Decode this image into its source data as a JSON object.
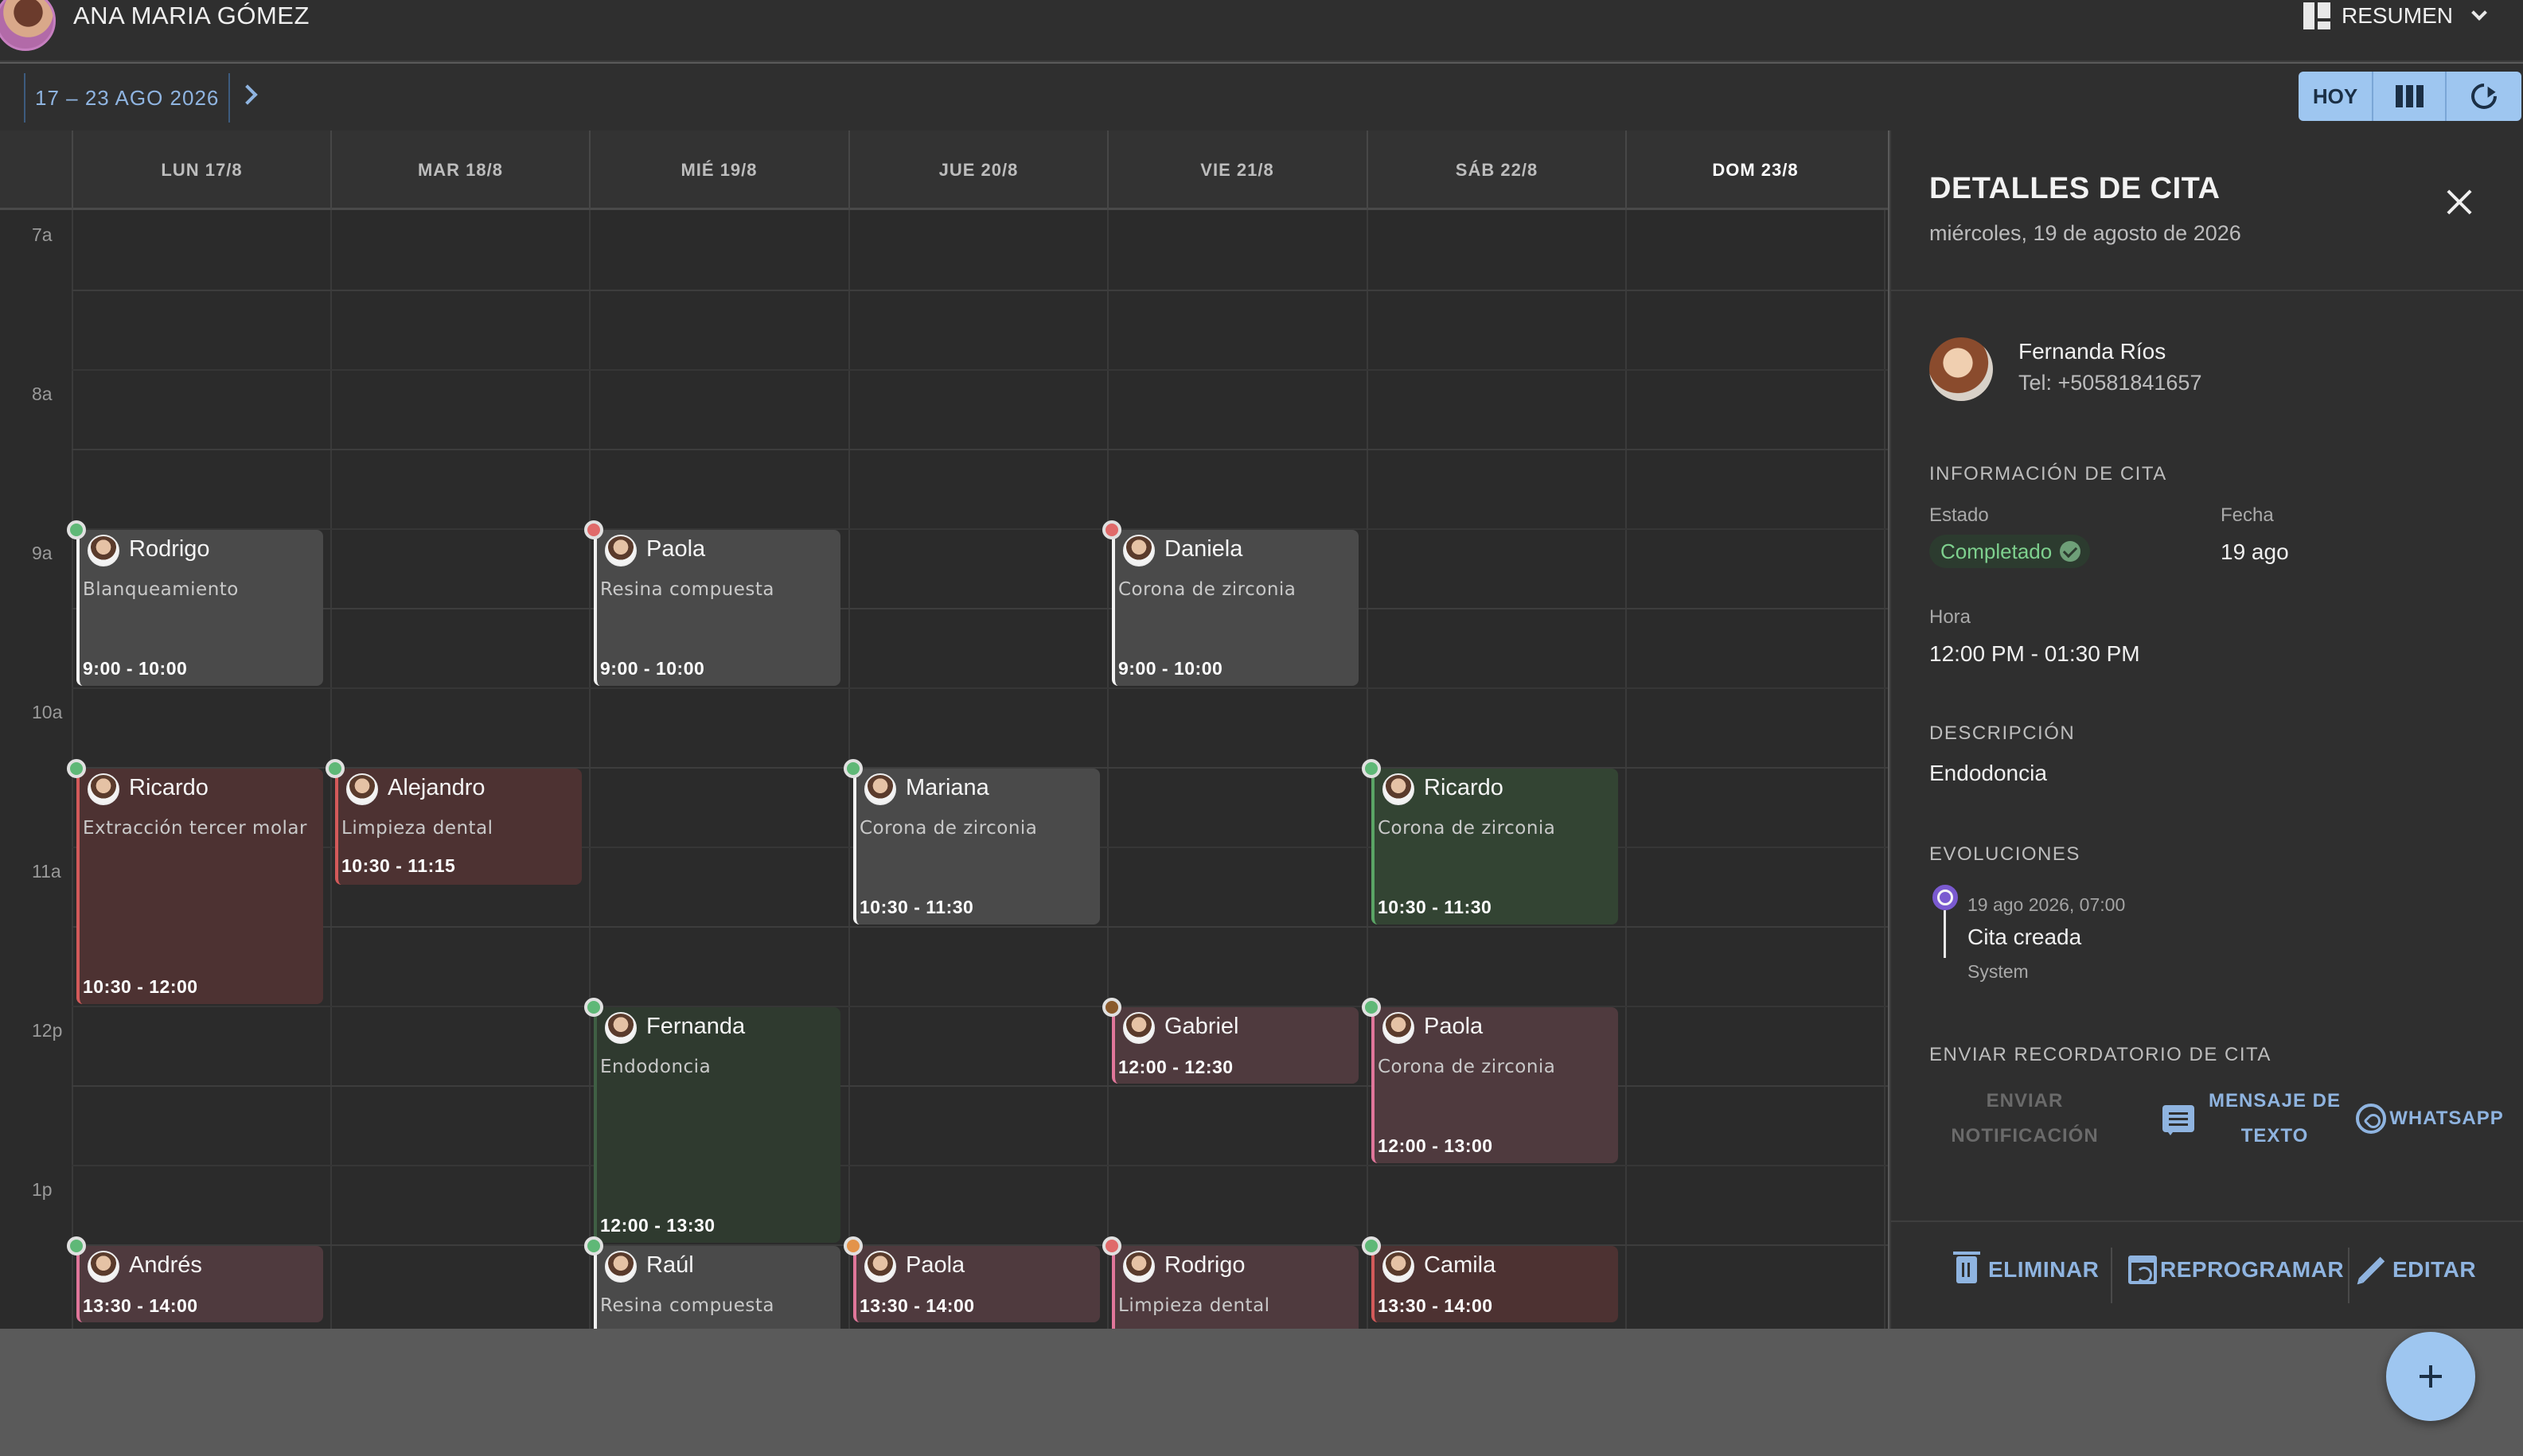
{
  "header": {
    "user_name": "ANA MARIA GÓMEZ",
    "summary_label": "RESUMEN"
  },
  "toolbar": {
    "date_range": "17 – 23 AGO 2026",
    "today_label": "HOY",
    "icons": [
      "chevron-right-icon",
      "columns-view-icon",
      "refresh-icon"
    ]
  },
  "calendar": {
    "days": [
      "LUN 17/8",
      "MAR 18/8",
      "MIÉ 19/8",
      "JUE 20/8",
      "VIE 21/8",
      "SÁB 22/8",
      "DOM 23/8"
    ],
    "hours": [
      "7a",
      "8a",
      "9a",
      "10a",
      "11a",
      "12p",
      "1p"
    ],
    "events": [
      {
        "name": "Rodrigo",
        "desc": "Blanqueamiento",
        "time": "9:00 - 10:00",
        "status_color": "#5fb877"
      },
      {
        "name": "Paola",
        "desc": "Resina compuesta",
        "time": "9:00 - 10:00",
        "status_color": "#e06a6a"
      },
      {
        "name": "Daniela",
        "desc": "Corona de zirconia",
        "time": "9:00 - 10:00",
        "status_color": "#e06a6a"
      },
      {
        "name": "Ricardo",
        "desc": "Extracción tercer molar",
        "time": "10:30 - 12:00",
        "status_color": "#5fb877"
      },
      {
        "name": "Alejandro",
        "desc": "Limpieza dental",
        "time": "10:30 - 11:15",
        "status_color": "#5fb877"
      },
      {
        "name": "Mariana",
        "desc": "Corona de zirconia",
        "time": "10:30 - 11:30",
        "status_color": "#5fb877"
      },
      {
        "name": "Ricardo",
        "desc": "Corona de zirconia",
        "time": "10:30 - 11:30",
        "status_color": "#5fb877"
      },
      {
        "name": "Fernanda",
        "desc": "Endodoncia",
        "time": "12:00 - 13:30",
        "status_color": "#5fb877"
      },
      {
        "name": "Gabriel",
        "desc": "",
        "time": "12:00 - 12:30",
        "status_color": "#8a5a2b"
      },
      {
        "name": "Paola",
        "desc": "Corona de zirconia",
        "time": "12:00 - 13:00",
        "status_color": "#5fb877"
      },
      {
        "name": "Andrés",
        "desc": "",
        "time": "13:30 - 14:00",
        "status_color": "#5fb877"
      },
      {
        "name": "Raúl",
        "desc": "Resina compuesta",
        "time": "",
        "status_color": "#5fb877"
      },
      {
        "name": "Paola",
        "desc": "",
        "time": "13:30 - 14:00",
        "status_color": "#e3934a"
      },
      {
        "name": "Rodrigo",
        "desc": "Limpieza dental",
        "time": "",
        "status_color": "#e06a6a"
      },
      {
        "name": "Camila",
        "desc": "",
        "time": "13:30 - 14:00",
        "status_color": "#5fb877"
      }
    ]
  },
  "detail": {
    "title": "DETALLES DE CITA",
    "subtitle": "miércoles, 19 de agosto de 2026",
    "patient_name": "Fernanda Ríos",
    "patient_phone": "Tel: +50581841657",
    "info_title": "INFORMACIÓN DE CITA",
    "estado_label": "Estado",
    "estado_value": "Completado",
    "fecha_label": "Fecha",
    "fecha_value": "19 ago",
    "hora_label": "Hora",
    "hora_value": "12:00 PM - 01:30 PM",
    "desc_title": "DESCRIPCIÓN",
    "desc_value": "Endodoncia",
    "evol_title": "EVOLUCIONES",
    "evol_date": "19 ago 2026, 07:00",
    "evol_text": "Cita creada",
    "evol_by": "System",
    "reminder_title": "ENVIAR RECORDATORIO DE CITA",
    "reminder_notification_1": "ENVIAR",
    "reminder_notification_2": "NOTIFICACIÓN",
    "reminder_sms_1": "MENSAJE DE",
    "reminder_sms_2": "TEXTO",
    "reminder_whatsapp": "WHATSAPP",
    "delete_label": "ELIMINAR",
    "reschedule_label": "REPROGRAMAR",
    "edit_label": "EDITAR"
  },
  "colors": {
    "accent": "#9ec6f0",
    "status_completed": "#5fb877",
    "status_cancelled": "#e06a6a",
    "status_pending": "#e3934a"
  }
}
